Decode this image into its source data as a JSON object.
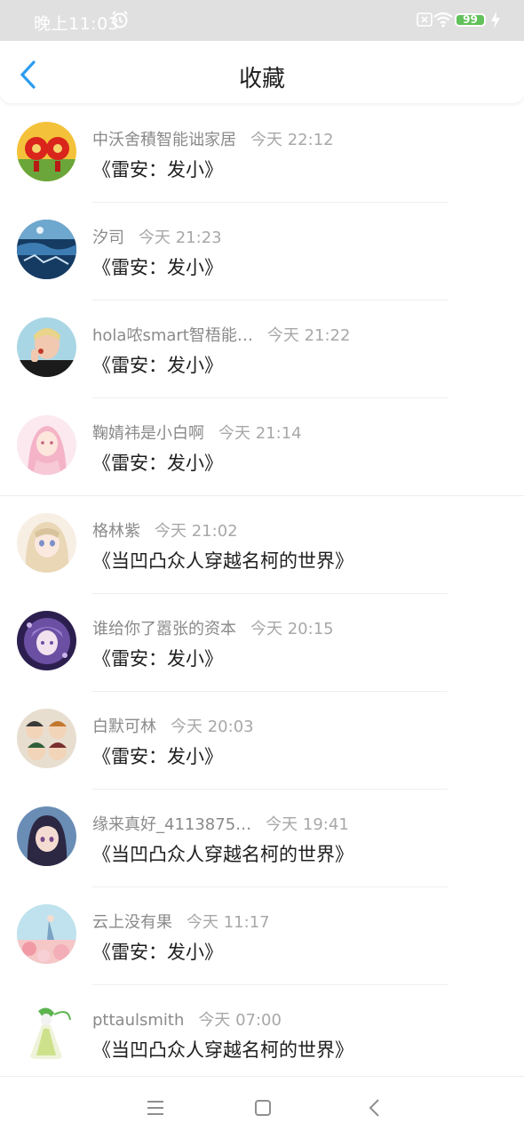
{
  "status_bar": {
    "time": "晚上11:03",
    "battery": "99",
    "icons": [
      "alarm-icon",
      "no-sim-icon",
      "wifi-icon",
      "battery-icon",
      "charging-icon"
    ]
  },
  "header": {
    "title": "收藏",
    "back_icon": "chevron-left-icon",
    "accent": "#2b9cf0"
  },
  "items": [
    {
      "name": "中沃舍積智能诎家居",
      "time": "今天 22:12",
      "title": "《雷安：发小》",
      "avatar": "red-lanterns-avatar"
    },
    {
      "name": "汐司",
      "time": "今天 21:23",
      "title": "《雷安：发小》",
      "avatar": "ocean-scene-avatar"
    },
    {
      "name": "hola哝smart智梧能…",
      "time": "今天 21:22",
      "title": "《雷安：发小》",
      "avatar": "blond-person-avatar"
    },
    {
      "name": "鞠婧祎是小白啊",
      "time": "今天 21:14",
      "title": "《雷安：发小》",
      "avatar": "pink-anime-girl-avatar"
    },
    {
      "name": "格林紫",
      "time": "今天 21:02",
      "title": "《当凹凸众人穿越名柯的世界》",
      "avatar": "anime-girl-avatar"
    },
    {
      "name": "谁给你了嚣张的资本",
      "time": "今天 20:15",
      "title": "《雷安：发小》",
      "avatar": "purple-anime-avatar"
    },
    {
      "name": "白默可林",
      "time": "今天 20:03",
      "title": "《雷安：发小》",
      "avatar": "group-anime-avatar"
    },
    {
      "name": "缘来真好_4113875…",
      "time": "今天 19:41",
      "title": "《当凹凸众人穿越名柯的世界》",
      "avatar": "dark-hair-anime-avatar"
    },
    {
      "name": "云上没有果",
      "time": "今天 11:17",
      "title": "《雷安：发小》",
      "avatar": "pastel-scene-avatar"
    },
    {
      "name": "pttaulsmith",
      "time": "今天 07:00",
      "title": "《当凹凸众人穿越名柯的世界》",
      "avatar": "gardevoir-avatar"
    }
  ],
  "bottom_nav": [
    "menu-icon",
    "home-icon",
    "back-icon"
  ]
}
